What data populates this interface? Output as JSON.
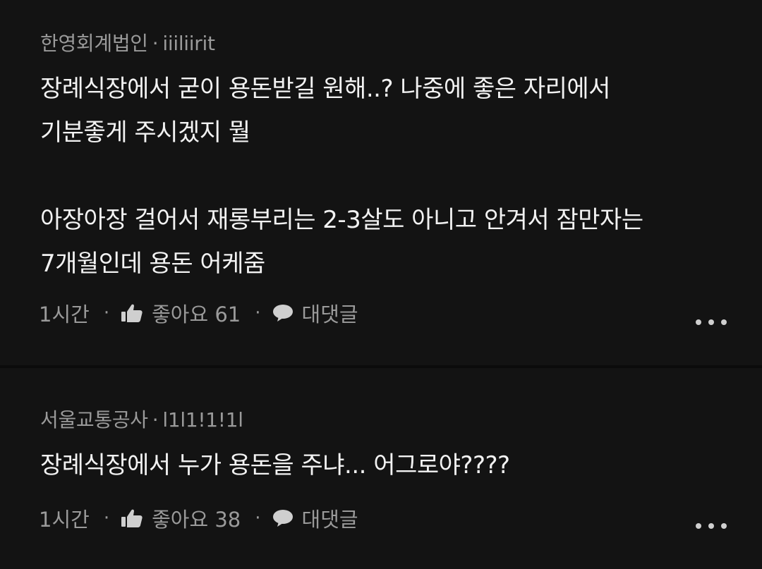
{
  "comments": [
    {
      "author": "한영회계법인",
      "separator": "·",
      "username": "iiiliirit",
      "lines": [
        "장례식장에서 굳이 용돈받길 원해..? 나중에 좋은 자리에서",
        "기분좋게 주시겠지 뭘",
        "",
        "아장아장 걸어서 재롱부리는 2-3살도 아니고 안겨서 잠만자는",
        "7개월인데 용돈 어케줌"
      ],
      "time": "1시간",
      "like_label": "좋아요 61",
      "reply_label": "대댓글"
    },
    {
      "author": "서울교통공사",
      "separator": "·",
      "username": "l1l1!1!1l",
      "lines": [
        "장례식장에서 누가 용돈을 주냐... 어그로야????"
      ],
      "time": "1시간",
      "like_label": "좋아요 38",
      "reply_label": "대댓글"
    }
  ],
  "icons": {
    "like": "thumbs-up-icon",
    "reply": "speech-bubble-icon",
    "more": "more-horizontal-icon"
  },
  "colors": {
    "background": "#131313",
    "primary_text": "#f2f2f2",
    "secondary_text": "#9a9a9a"
  }
}
